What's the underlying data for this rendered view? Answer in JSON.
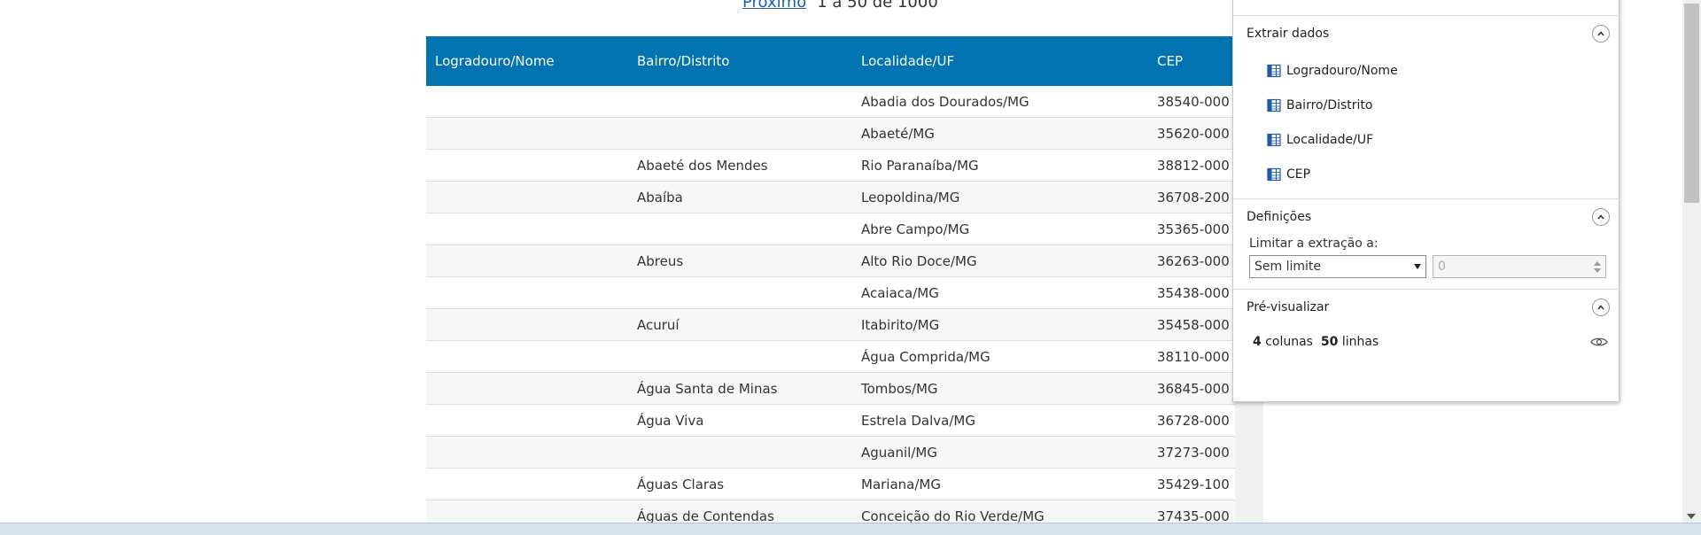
{
  "pagination": {
    "next_label": "Próximo",
    "range_text": "1 a 50 de 1000"
  },
  "table": {
    "headers": [
      "Logradouro/Nome",
      "Bairro/Distrito",
      "Localidade/UF",
      "CEP"
    ],
    "rows": [
      [
        "",
        "",
        "Abadia dos Dourados/MG",
        "38540-000"
      ],
      [
        "",
        "",
        "Abaeté/MG",
        "35620-000"
      ],
      [
        "",
        "Abaeté dos Mendes",
        "Rio Paranaíba/MG",
        "38812-000"
      ],
      [
        "",
        "Abaíba",
        "Leopoldina/MG",
        "36708-200"
      ],
      [
        "",
        "",
        "Abre Campo/MG",
        "35365-000"
      ],
      [
        "",
        "Abreus",
        "Alto Rio Doce/MG",
        "36263-000"
      ],
      [
        "",
        "",
        "Acaiaca/MG",
        "35438-000"
      ],
      [
        "",
        "Acuruí",
        "Itabirito/MG",
        "35458-000"
      ],
      [
        "",
        "",
        "Água Comprida/MG",
        "38110-000"
      ],
      [
        "",
        "Água Santa de Minas",
        "Tombos/MG",
        "36845-000"
      ],
      [
        "",
        "Água Viva",
        "Estrela Dalva/MG",
        "36728-000"
      ],
      [
        "",
        "",
        "Aguanil/MG",
        "37273-000"
      ],
      [
        "",
        "Águas Claras",
        "Mariana/MG",
        "35429-100"
      ],
      [
        "",
        "Águas de Contendas",
        "Conceição do Rio Verde/MG",
        "37435-000"
      ]
    ]
  },
  "panel": {
    "extract_title": "Extrair dados",
    "fields": [
      "Logradouro/Nome",
      "Bairro/Distrito",
      "Localidade/UF",
      "CEP"
    ],
    "settings_title": "Definições",
    "limit_label": "Limitar a extração a:",
    "limit_select_value": "Sem limite",
    "limit_number_value": "0",
    "preview_title": "Pré-visualizar",
    "preview_columns_count": "4",
    "preview_columns_label": "colunas",
    "preview_rows_count": "50",
    "preview_rows_label": "linhas"
  },
  "colors": {
    "header_bg": "#0073b0",
    "link": "#1a5fb4",
    "icon_blue": "#1e5aa8"
  },
  "icons": [
    "table-column-icon",
    "chevron-up-icon",
    "eye-icon",
    "dropdown-caret-icon"
  ]
}
